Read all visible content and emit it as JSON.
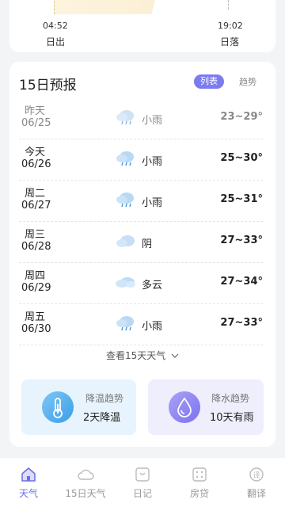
{
  "sun": {
    "sunrise_time": "04:52",
    "sunrise_label": "日出",
    "sunset_time": "19:02",
    "sunset_label": "日落"
  },
  "forecast": {
    "title": "15日预报",
    "tab_list": "列表",
    "tab_trend": "趋势",
    "rows": [
      {
        "day": "昨天",
        "date": "06/25",
        "icon": "cloud-rain-icon",
        "desc": "小雨",
        "temp": "23~29°"
      },
      {
        "day": "今天",
        "date": "06/26",
        "icon": "cloud-rain-icon",
        "desc": "小雨",
        "temp": "25~30°"
      },
      {
        "day": "周二",
        "date": "06/27",
        "icon": "cloud-rain-icon",
        "desc": "小雨",
        "temp": "25~31°"
      },
      {
        "day": "周三",
        "date": "06/28",
        "icon": "cloud-icon",
        "desc": "阴",
        "temp": "27~33°"
      },
      {
        "day": "周四",
        "date": "06/29",
        "icon": "partly-cloudy-icon",
        "desc": "多云",
        "temp": "27~34°"
      },
      {
        "day": "周五",
        "date": "06/30",
        "icon": "cloud-rain-icon",
        "desc": "小雨",
        "temp": "27~33°"
      }
    ],
    "more_label": "查看15天天气"
  },
  "trends": {
    "cooling_title": "降温趋势",
    "cooling_value": "2天降温",
    "rain_title": "降水趋势",
    "rain_value": "10天有雨"
  },
  "nav": {
    "items": [
      {
        "label": "天气",
        "icon": "home-icon"
      },
      {
        "label": "15日天气",
        "icon": "cloud-icon"
      },
      {
        "label": "日记",
        "icon": "diary-icon"
      },
      {
        "label": "房贷",
        "icon": "calculator-icon"
      },
      {
        "label": "翻译",
        "icon": "translate-icon"
      }
    ]
  },
  "colors": {
    "accent": "#7c7cf0",
    "nav_active": "#6a6ee8",
    "cooling_bg": "#e8f4fd",
    "rain_bg": "#eeeefc"
  }
}
